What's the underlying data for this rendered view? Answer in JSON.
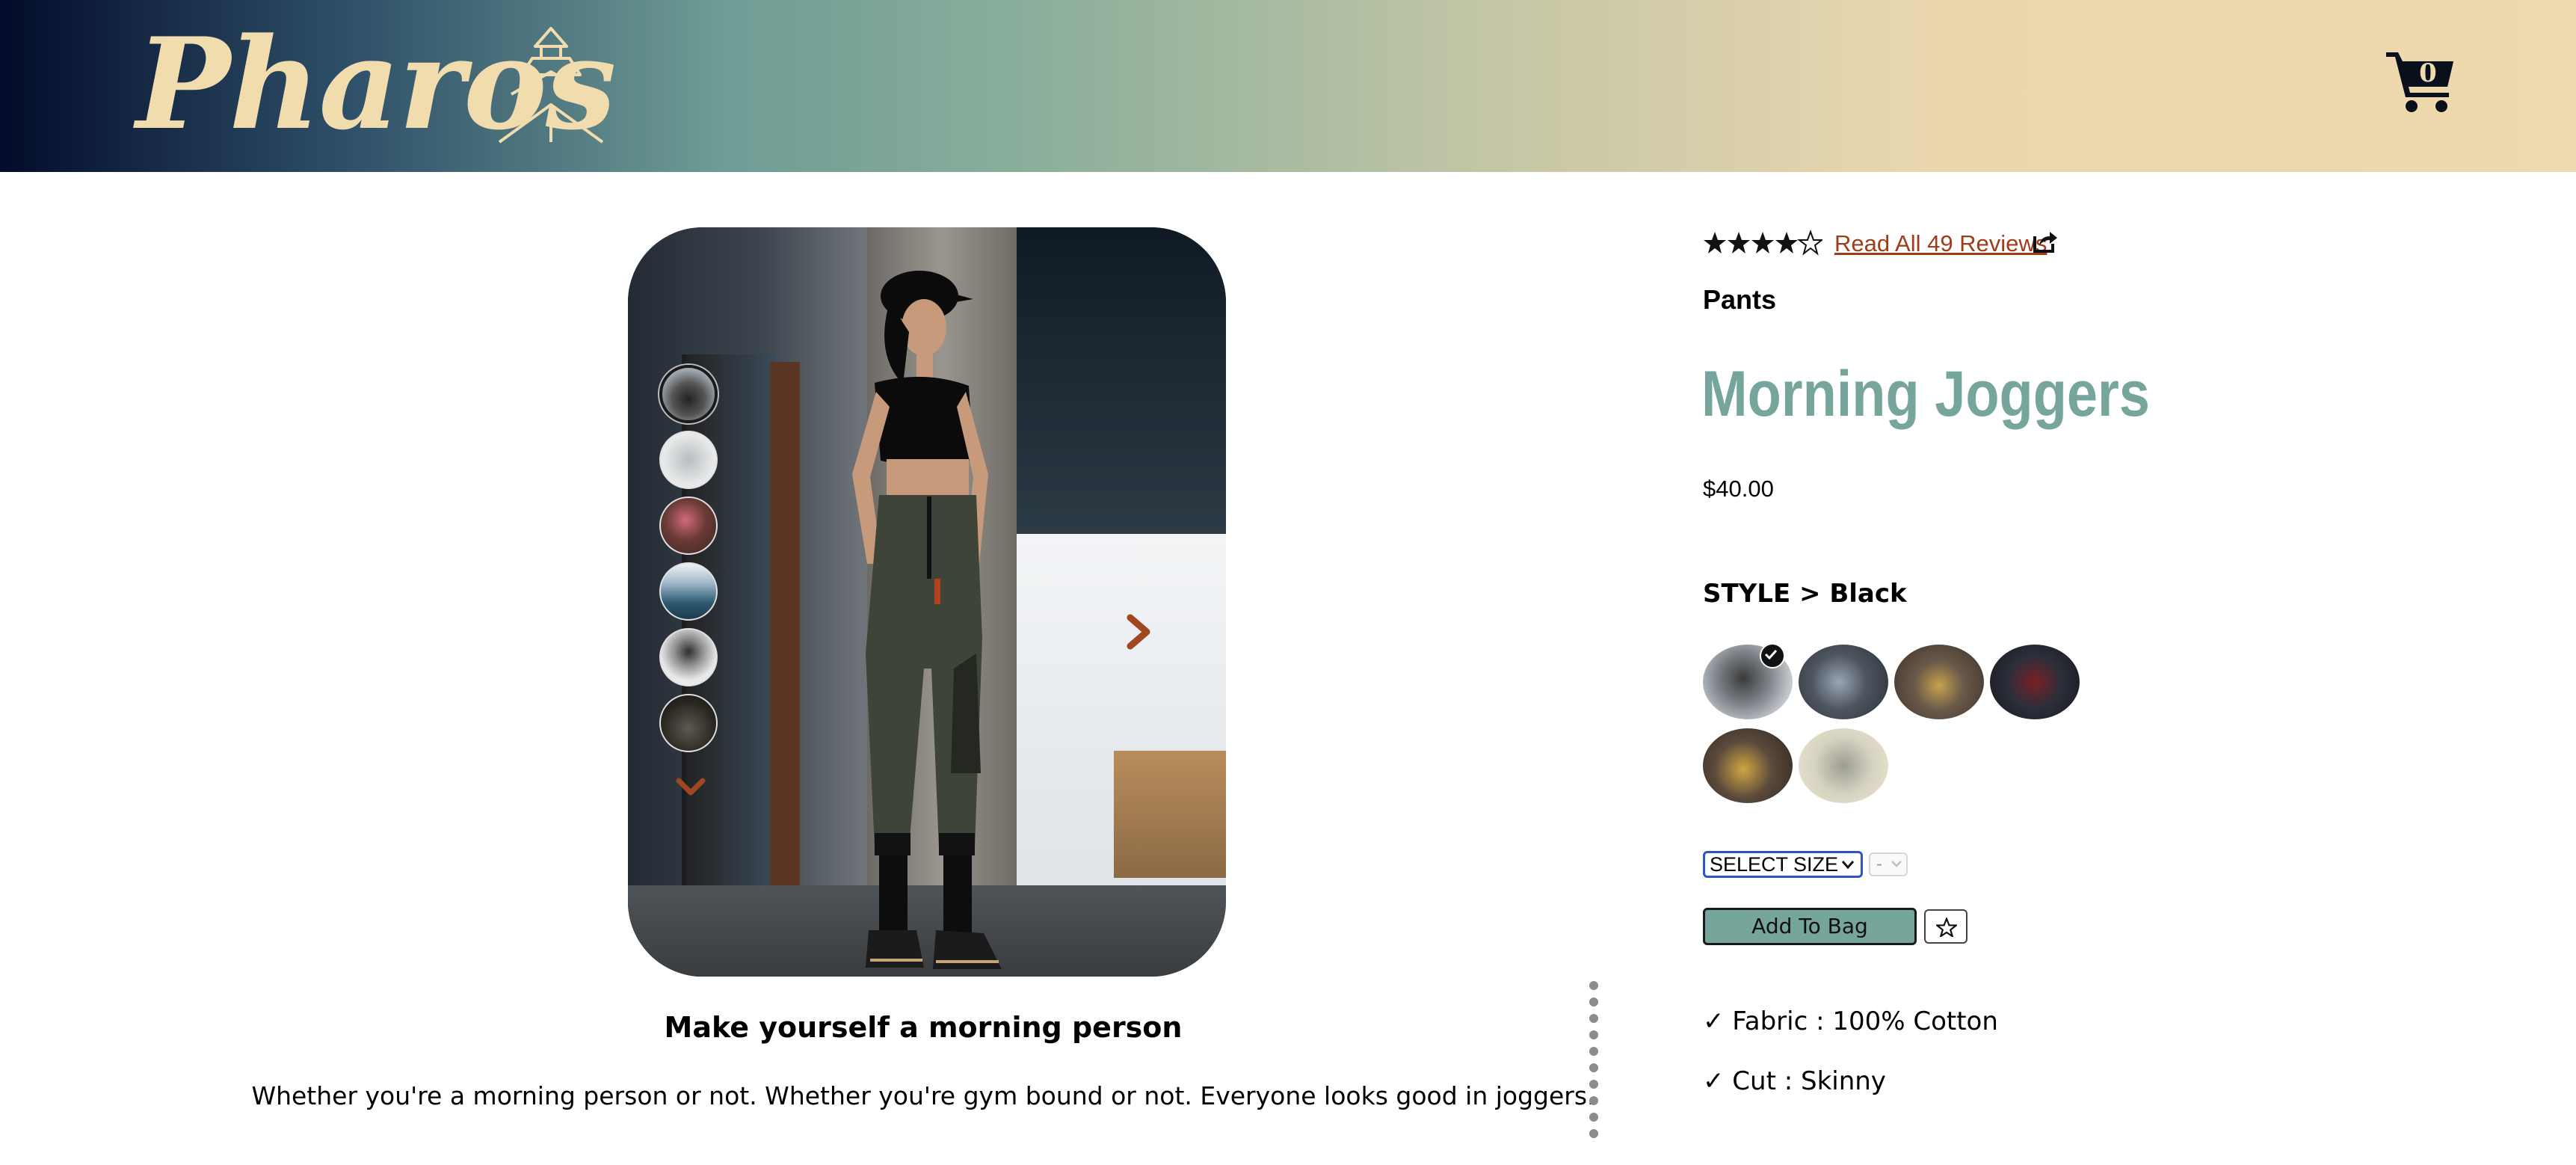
{
  "header": {
    "logo_text": "Pharos",
    "logo_icon": "lighthouse-icon",
    "cart_icon": "cart-icon",
    "cart_count": "0"
  },
  "gallery": {
    "main_image_alt": "woman-in-black-crop-top-and-joggers",
    "thumbnail_count": 6,
    "active_thumbnail": 1,
    "next_icon": "chevron-right-icon",
    "scroll_thumbs_icon": "chevron-down-icon"
  },
  "description": {
    "tagline": "Make yourself a morning person",
    "body": "Whether you're a morning person or not. Whether you're gym bound or not. Everyone looks good in joggers."
  },
  "product": {
    "rating": 4,
    "rating_max": 5,
    "reviews_link": "Read All 49 Reviews",
    "share_icon": "share-icon",
    "category": "Pants",
    "name": "Morning Joggers",
    "price": "$40.00",
    "style_label": "STYLE > Black",
    "swatches_count": 6,
    "selected_swatch": 1,
    "size_select": "SELECT SIZE",
    "qty_select": "-",
    "add_to_bag": "Add To Bag",
    "favorite_icon": "star-outline-icon",
    "features": [
      "✓ Fabric : 100% Cotton",
      "✓ Cut : Skinny"
    ]
  },
  "colors": {
    "accent_teal": "#76a59c",
    "link_rust": "#9d3d1a",
    "header_dark": "#030c2a",
    "header_cream": "#efd9ae"
  }
}
